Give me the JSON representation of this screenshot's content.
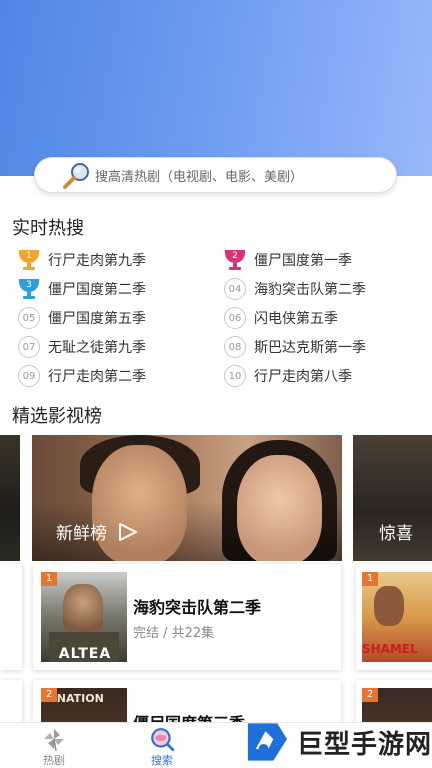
{
  "search": {
    "placeholder": "搜高清热剧（电视剧、电影、美剧）"
  },
  "hot_search": {
    "title": "实时热搜",
    "items": [
      {
        "rank": "1",
        "label": "行尸走肉第九季",
        "style": "trophy",
        "color": "#f0a530"
      },
      {
        "rank": "2",
        "label": "僵尸国度第一季",
        "style": "trophy",
        "color": "#d6337c"
      },
      {
        "rank": "3",
        "label": "僵尸国度第二季",
        "style": "trophy",
        "color": "#2f9ee0"
      },
      {
        "rank": "04",
        "label": "海豹突击队第二季",
        "style": "circle"
      },
      {
        "rank": "05",
        "label": "僵尸国度第五季",
        "style": "circle"
      },
      {
        "rank": "06",
        "label": "闪电侠第五季",
        "style": "circle"
      },
      {
        "rank": "07",
        "label": "无耻之徒第九季",
        "style": "circle"
      },
      {
        "rank": "08",
        "label": "斯巴达克斯第一季",
        "style": "circle"
      },
      {
        "rank": "09",
        "label": "行尸走肉第二季",
        "style": "circle"
      },
      {
        "rank": "10",
        "label": "行尸走肉第八季",
        "style": "circle"
      }
    ]
  },
  "featured": {
    "title": "精选影视榜",
    "banners": [
      {
        "label": "新鲜榜"
      },
      {
        "label": "惊喜"
      }
    ],
    "cards": [
      {
        "badge": "1",
        "title": "海豹突击队第二季",
        "subtitle": "完结 / 共22集",
        "poster_text": "ALTEA"
      },
      {
        "badge": "2",
        "title": "僵尸国度第三季",
        "subtitle": "",
        "poster_text": "Z NATION"
      }
    ],
    "side_cards": [
      {
        "badge": "1",
        "poster_text": "SHAMEL"
      },
      {
        "badge": "2"
      }
    ]
  },
  "tabbar": {
    "tabs": [
      {
        "label": "热剧",
        "active": false
      },
      {
        "label": "搜索",
        "active": true,
        "color": "#2f6fdc"
      }
    ]
  },
  "watermark": {
    "text": "巨型手游网"
  }
}
